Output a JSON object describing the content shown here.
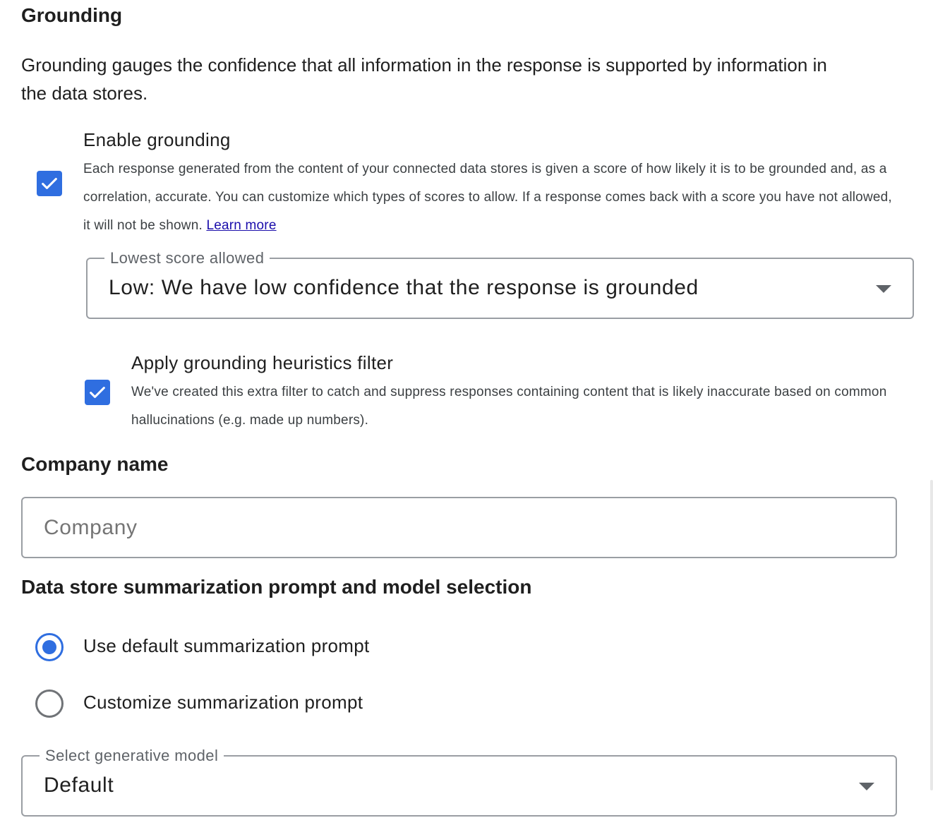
{
  "grounding": {
    "title": "Grounding",
    "description": "Grounding gauges the confidence that all information in the response is supported by information in the data stores.",
    "enable": {
      "label": "Enable grounding",
      "checked": true,
      "description": "Each response generated from the content of your connected data stores is given a score of how likely it is to be grounded and, as a correlation, accurate. You can customize which types of scores to allow. If a response comes back with a score you have not allowed, it will not be shown.",
      "learn_more": "Learn more"
    },
    "lowest_score": {
      "label": "Lowest score allowed",
      "value": "Low: We have low confidence that the response is grounded"
    },
    "heuristics": {
      "label": "Apply grounding heuristics filter",
      "checked": true,
      "description": "We've created this extra filter to catch and suppress responses containing content that is likely inaccurate based on common hallucinations (e.g. made up numbers)."
    }
  },
  "company": {
    "title": "Company name",
    "placeholder": "Company",
    "value": ""
  },
  "summarization": {
    "title": "Data store summarization prompt and model selection",
    "options": [
      {
        "label": "Use default summarization prompt",
        "selected": true
      },
      {
        "label": "Customize summarization prompt",
        "selected": false
      }
    ],
    "model": {
      "label": "Select generative model",
      "value": "Default"
    }
  },
  "colors": {
    "accent": "#2f6ee0",
    "text": "#1f1f1f",
    "secondary_text": "#5f6368",
    "border": "#9a9ea3"
  },
  "icons": {
    "checkbox": "check-icon",
    "dropdown": "arrow-drop-down-icon"
  }
}
